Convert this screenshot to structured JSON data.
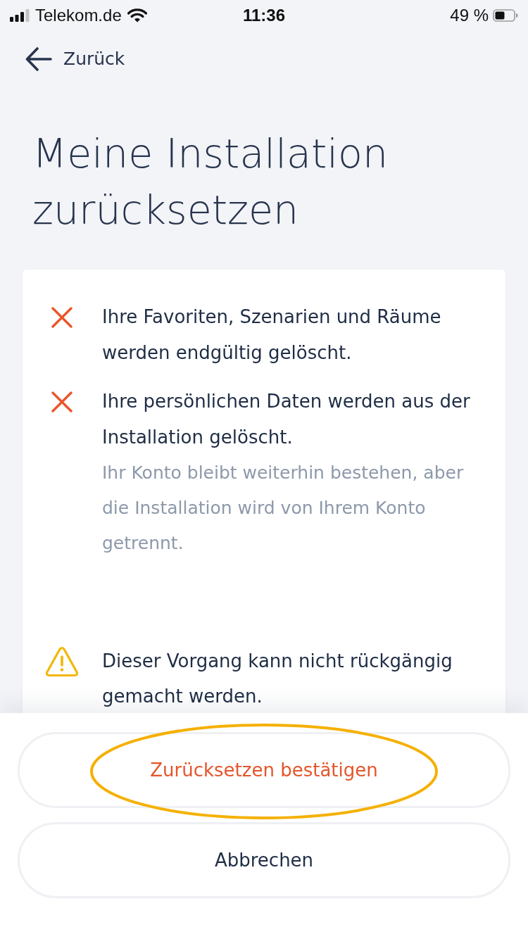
{
  "status_bar": {
    "carrier": "Telekom.de",
    "time": "11:36",
    "battery": "49 %"
  },
  "nav": {
    "back_label": "Zurück"
  },
  "title": "Meine Installation zurücksetzen",
  "consequences": [
    {
      "kind": "delete",
      "text": "Ihre Favoriten, Szenarien und Räume werden endgültig gelöscht."
    },
    {
      "kind": "delete",
      "text": "Ihre persönlichen Daten werden aus der Installation gelöscht.",
      "note": "Ihr Konto bleibt weiterhin bestehen, aber die Installation wird von Ihrem Konto getrennt."
    },
    {
      "kind": "warning",
      "text": "Dieser Vorgang kann nicht rückgängig gemacht werden."
    }
  ],
  "buttons": [
    {
      "label": "Zurücksetzen bestätigen",
      "kind": "destructive",
      "highlighted": true
    },
    {
      "label": "Abbrechen",
      "kind": "neutral",
      "highlighted": false
    }
  ]
}
